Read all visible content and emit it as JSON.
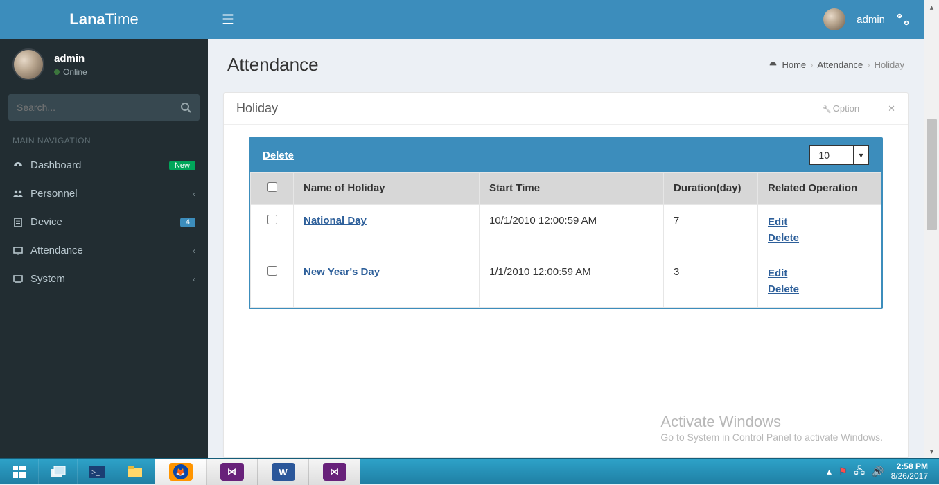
{
  "brand": {
    "first": "Lana",
    "second": "Time"
  },
  "user": {
    "name": "admin",
    "status": "Online"
  },
  "search": {
    "placeholder": "Search..."
  },
  "nav_header": "MAIN NAVIGATION",
  "sidebar": {
    "items": [
      {
        "icon": "dashboard",
        "label": "Dashboard",
        "badge": "New",
        "badge_style": "green"
      },
      {
        "icon": "users",
        "label": "Personnel",
        "chevron": true
      },
      {
        "icon": "device",
        "label": "Device",
        "badge": "4",
        "badge_style": "blue"
      },
      {
        "icon": "monitor",
        "label": "Attendance",
        "chevron": true
      },
      {
        "icon": "system",
        "label": "System",
        "chevron": true
      }
    ]
  },
  "topbar": {
    "user": "admin"
  },
  "page": {
    "title": "Attendance",
    "crumbs": {
      "home": "Home",
      "mid": "Attendance",
      "leaf": "Holiday"
    }
  },
  "panel": {
    "title": "Holiday",
    "option_label": "Option",
    "inner": {
      "delete_label": "Delete",
      "page_size": "10"
    },
    "columns": {
      "name": "Name of Holiday",
      "start": "Start Time",
      "duration": "Duration(day)",
      "ops": "Related Operation"
    },
    "ops": {
      "edit": "Edit",
      "delete": "Delete"
    },
    "rows": [
      {
        "name": "National Day",
        "start": "10/1/2010 12:00:59 AM",
        "duration": "7"
      },
      {
        "name": "New Year's Day",
        "start": "1/1/2010 12:00:59 AM",
        "duration": "3"
      }
    ]
  },
  "watermark": {
    "line1": "Activate Windows",
    "line2": "Go to System in Control Panel to activate Windows."
  },
  "taskbar": {
    "clock_time": "2:58 PM",
    "clock_date": "8/26/2017"
  }
}
